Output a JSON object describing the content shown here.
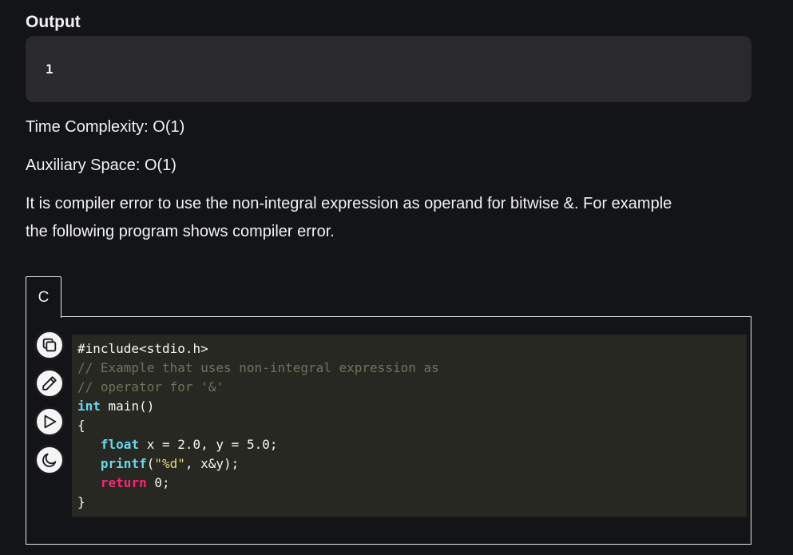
{
  "output": {
    "heading": "Output",
    "value": "1"
  },
  "paragraphs": {
    "time_complexity": "Time Complexity: O(1)",
    "auxiliary_space": "Auxiliary Space: O(1)",
    "description_line1": "It is compiler error to use the non-integral expression as operand for bitwise &. For example",
    "description_line2": "the following program shows compiler error."
  },
  "code_block": {
    "language_tab": "C",
    "tools": [
      "copy-icon",
      "pencil-icon",
      "play-icon",
      "moon-icon"
    ],
    "lines": {
      "l1": "#include<stdio.h>",
      "l2": "// Example that uses non-integral expression as",
      "l3": "// operator for '&'",
      "l4_type": "int",
      "l4_rest": " main()",
      "l5": "{",
      "l6_indent": "   ",
      "l6_type": "float",
      "l6_rest": " x = 2.0, y = 5.0;",
      "l7_indent": "   ",
      "l7_fn": "printf",
      "l7_open": "(",
      "l7_str": "\"%d\"",
      "l7_rest": ", x&y);",
      "l8_indent": "   ",
      "l8_kw": "return",
      "l8_rest": " 0;",
      "l9": "}"
    }
  },
  "colors": {
    "background": "#131417",
    "output_box": "#2a2a2e",
    "code_background": "#272822",
    "comment": "#75715e",
    "type": "#66d9ef",
    "keyword": "#f92672",
    "string": "#e6db74"
  }
}
